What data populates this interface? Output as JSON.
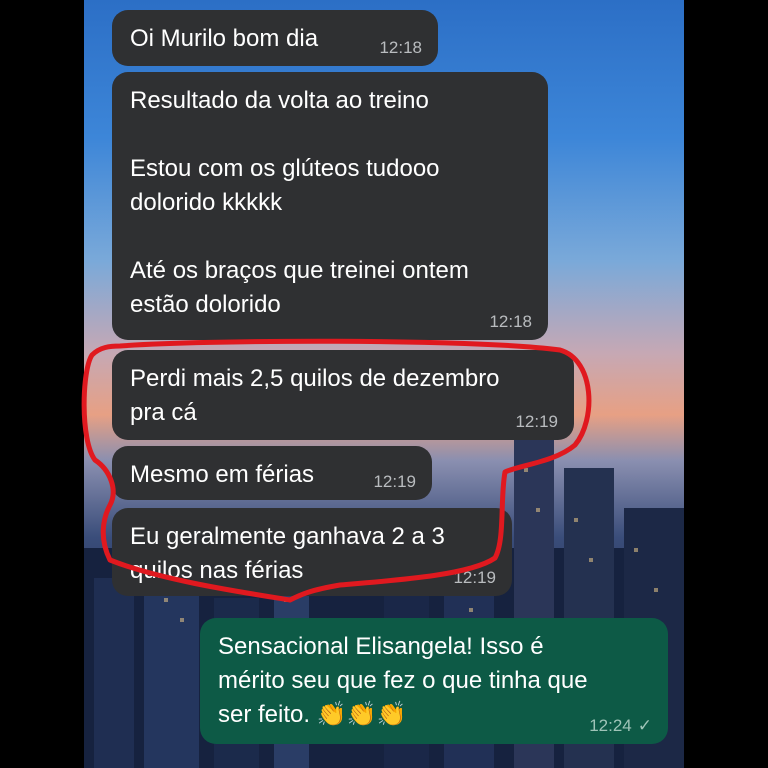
{
  "colors": {
    "incoming_bubble": "#2f3032",
    "outgoing_bubble": "#0d5a46",
    "highlight": "#e0191f"
  },
  "messages": [
    {
      "text": "Oi Murilo bom dia",
      "time": "12:18",
      "direction": "incoming"
    },
    {
      "text": "Resultado da volta ao treino\n\nEstou com os glúteos tudooo\ndolorido kkkkk\n\nAté os braços que treinei ontem\nestão dolorido",
      "time": "12:18",
      "direction": "incoming"
    },
    {
      "text": "Perdi mais 2,5 quilos de dezembro\npra cá",
      "time": "12:19",
      "direction": "incoming"
    },
    {
      "text": "Mesmo em férias",
      "time": "12:19",
      "direction": "incoming"
    },
    {
      "text": "Eu geralmente ganhava 2 a 3\nquilos nas férias",
      "time": "12:19",
      "direction": "incoming"
    },
    {
      "text": "Sensacional Elisangela! Isso é\nmérito seu que fez o que tinha que\nser feito. 👏👏👏",
      "time": "12:24",
      "direction": "outgoing",
      "status_icon": "check-icon"
    }
  ]
}
